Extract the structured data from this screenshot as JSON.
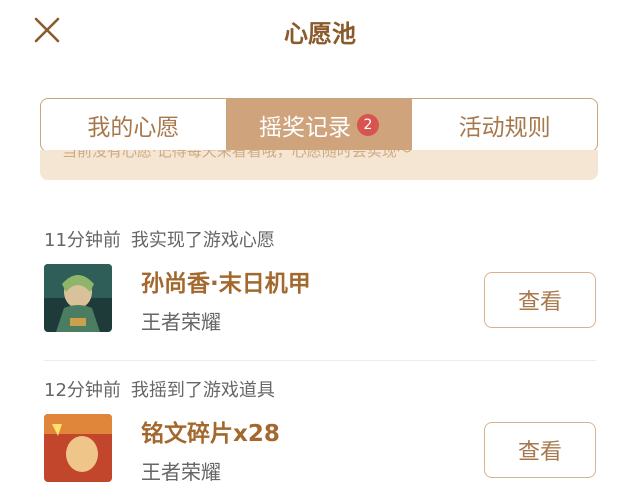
{
  "header": {
    "title": "心愿池"
  },
  "tabs": [
    {
      "label": "我的心愿"
    },
    {
      "label": "摇奖记录",
      "badge": "2"
    },
    {
      "label": "活动规则"
    }
  ],
  "banner": {
    "text": "当前没有心愿·记得每天来看看哦，心愿随时会实现～"
  },
  "records": [
    {
      "time": "11分钟前",
      "action": "我实现了游戏心愿",
      "item_name": "孙尚香·末日机甲",
      "game": "王者荣耀",
      "button": "查看"
    },
    {
      "time": "12分钟前",
      "action": "我摇到了游戏道具",
      "item_name": "铭文碎片x28",
      "game": "王者荣耀",
      "button": "查看"
    }
  ],
  "colors": {
    "accent": "#cfa47c",
    "title": "#8a5a2b",
    "badge": "#d9534f"
  }
}
